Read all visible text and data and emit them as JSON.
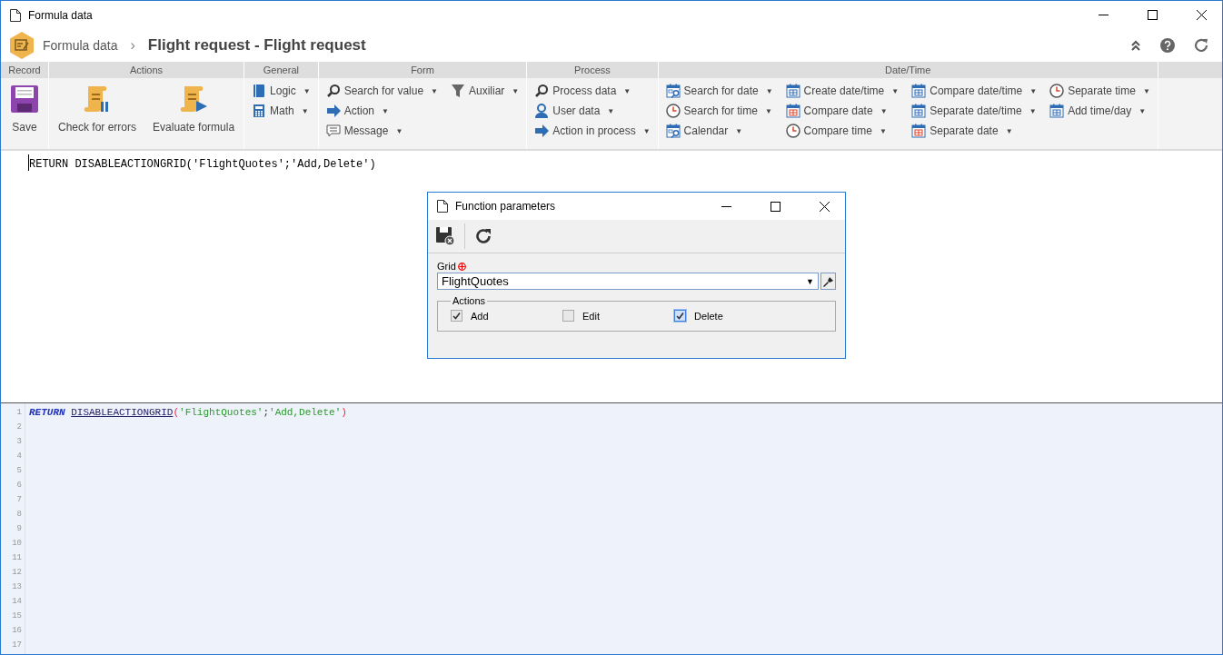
{
  "window": {
    "title": "Formula data"
  },
  "header": {
    "breadcrumb": "Formula data",
    "separator": "›",
    "title": "Flight request - Flight request"
  },
  "ribbon": [
    {
      "label": "Record",
      "columns": [
        [
          {
            "label": "Save",
            "kind": "save",
            "large": true
          }
        ]
      ]
    },
    {
      "label": "Actions",
      "columns": [
        [
          {
            "label": "Check for errors",
            "kind": "scroll-bars",
            "large": true
          }
        ],
        [
          {
            "label": "Evaluate formula",
            "kind": "scroll-play",
            "large": true
          }
        ]
      ]
    },
    {
      "label": "General",
      "columns": [
        [
          {
            "label": "Logic",
            "kind": "book",
            "caret": "▼"
          },
          {
            "label": "Math",
            "kind": "calculator",
            "caret": "▼"
          }
        ]
      ]
    },
    {
      "label": "Form",
      "columns": [
        [
          {
            "label": "Search for value",
            "kind": "magnifier",
            "caret": "▼"
          },
          {
            "label": "Action",
            "kind": "arrow",
            "caret": "▼"
          },
          {
            "label": "Message",
            "kind": "message",
            "caret": "▼"
          }
        ],
        [
          {
            "label": "Auxiliar",
            "kind": "funnel",
            "caret": "▼"
          }
        ]
      ]
    },
    {
      "label": "Process",
      "columns": [
        [
          {
            "label": "Process data",
            "kind": "magnifier",
            "caret": "▼"
          },
          {
            "label": "User data",
            "kind": "user",
            "caret": "▼"
          },
          {
            "label": "Action in process",
            "kind": "arrow",
            "caret": "▼"
          }
        ]
      ]
    },
    {
      "label": "Date/Time",
      "columns": [
        [
          {
            "label": "Search for date",
            "kind": "calendar-search",
            "caret": "▼"
          },
          {
            "label": "Search for time",
            "kind": "clock",
            "caret": "▼"
          },
          {
            "label": "Calendar",
            "kind": "calendar-search",
            "caret": "▼"
          }
        ],
        [
          {
            "label": "Create date/time",
            "kind": "calendar",
            "caret": "▼"
          },
          {
            "label": "Compare date",
            "kind": "calendar-red",
            "caret": "▼"
          },
          {
            "label": "Compare time",
            "kind": "clock",
            "caret": "▼"
          }
        ],
        [
          {
            "label": "Compare date/time",
            "kind": "calendar",
            "caret": "▼"
          },
          {
            "label": "Separate date/time",
            "kind": "calendar",
            "caret": "▼"
          },
          {
            "label": "Separate date",
            "kind": "calendar-red",
            "caret": "▼"
          }
        ],
        [
          {
            "label": "Separate time",
            "kind": "clock",
            "caret": "▼"
          },
          {
            "label": "Add time/day",
            "kind": "calendar",
            "caret": "▼"
          }
        ]
      ]
    }
  ],
  "formula_text": "RETURN DISABLEACTIONGRID('FlightQuotes';'Add,Delete')",
  "dialog": {
    "title": "Function parameters",
    "grid_label": "Grid",
    "grid_value": "FlightQuotes",
    "select_caret": "▼",
    "actions_legend": "Actions",
    "checkboxes": [
      {
        "label": "Add",
        "checked": true,
        "focused": false
      },
      {
        "label": "Edit",
        "checked": false,
        "focused": false
      },
      {
        "label": "Delete",
        "checked": true,
        "focused": true
      }
    ]
  },
  "code_editor": {
    "lines": [
      {
        "number": "1",
        "tokens": [
          {
            "kind": "keyword",
            "text": "RETURN"
          },
          {
            "kind": "function",
            "text": "DISABLEACTIONGRID"
          },
          {
            "kind": "paren",
            "text": "("
          },
          {
            "kind": "string",
            "text": "'FlightQuotes'"
          },
          {
            "kind": "punct",
            "text": ";"
          },
          {
            "kind": "string",
            "text": "'Add,Delete'"
          },
          {
            "kind": "paren",
            "text": ")"
          }
        ]
      },
      {
        "number": "2"
      },
      {
        "number": "3"
      },
      {
        "number": "4"
      },
      {
        "number": "5"
      },
      {
        "number": "6"
      },
      {
        "number": "7"
      },
      {
        "number": "8"
      },
      {
        "number": "9"
      },
      {
        "number": "10"
      },
      {
        "number": "11"
      },
      {
        "number": "12"
      },
      {
        "number": "13"
      },
      {
        "number": "14"
      },
      {
        "number": "15"
      },
      {
        "number": "16"
      },
      {
        "number": "17"
      }
    ]
  }
}
